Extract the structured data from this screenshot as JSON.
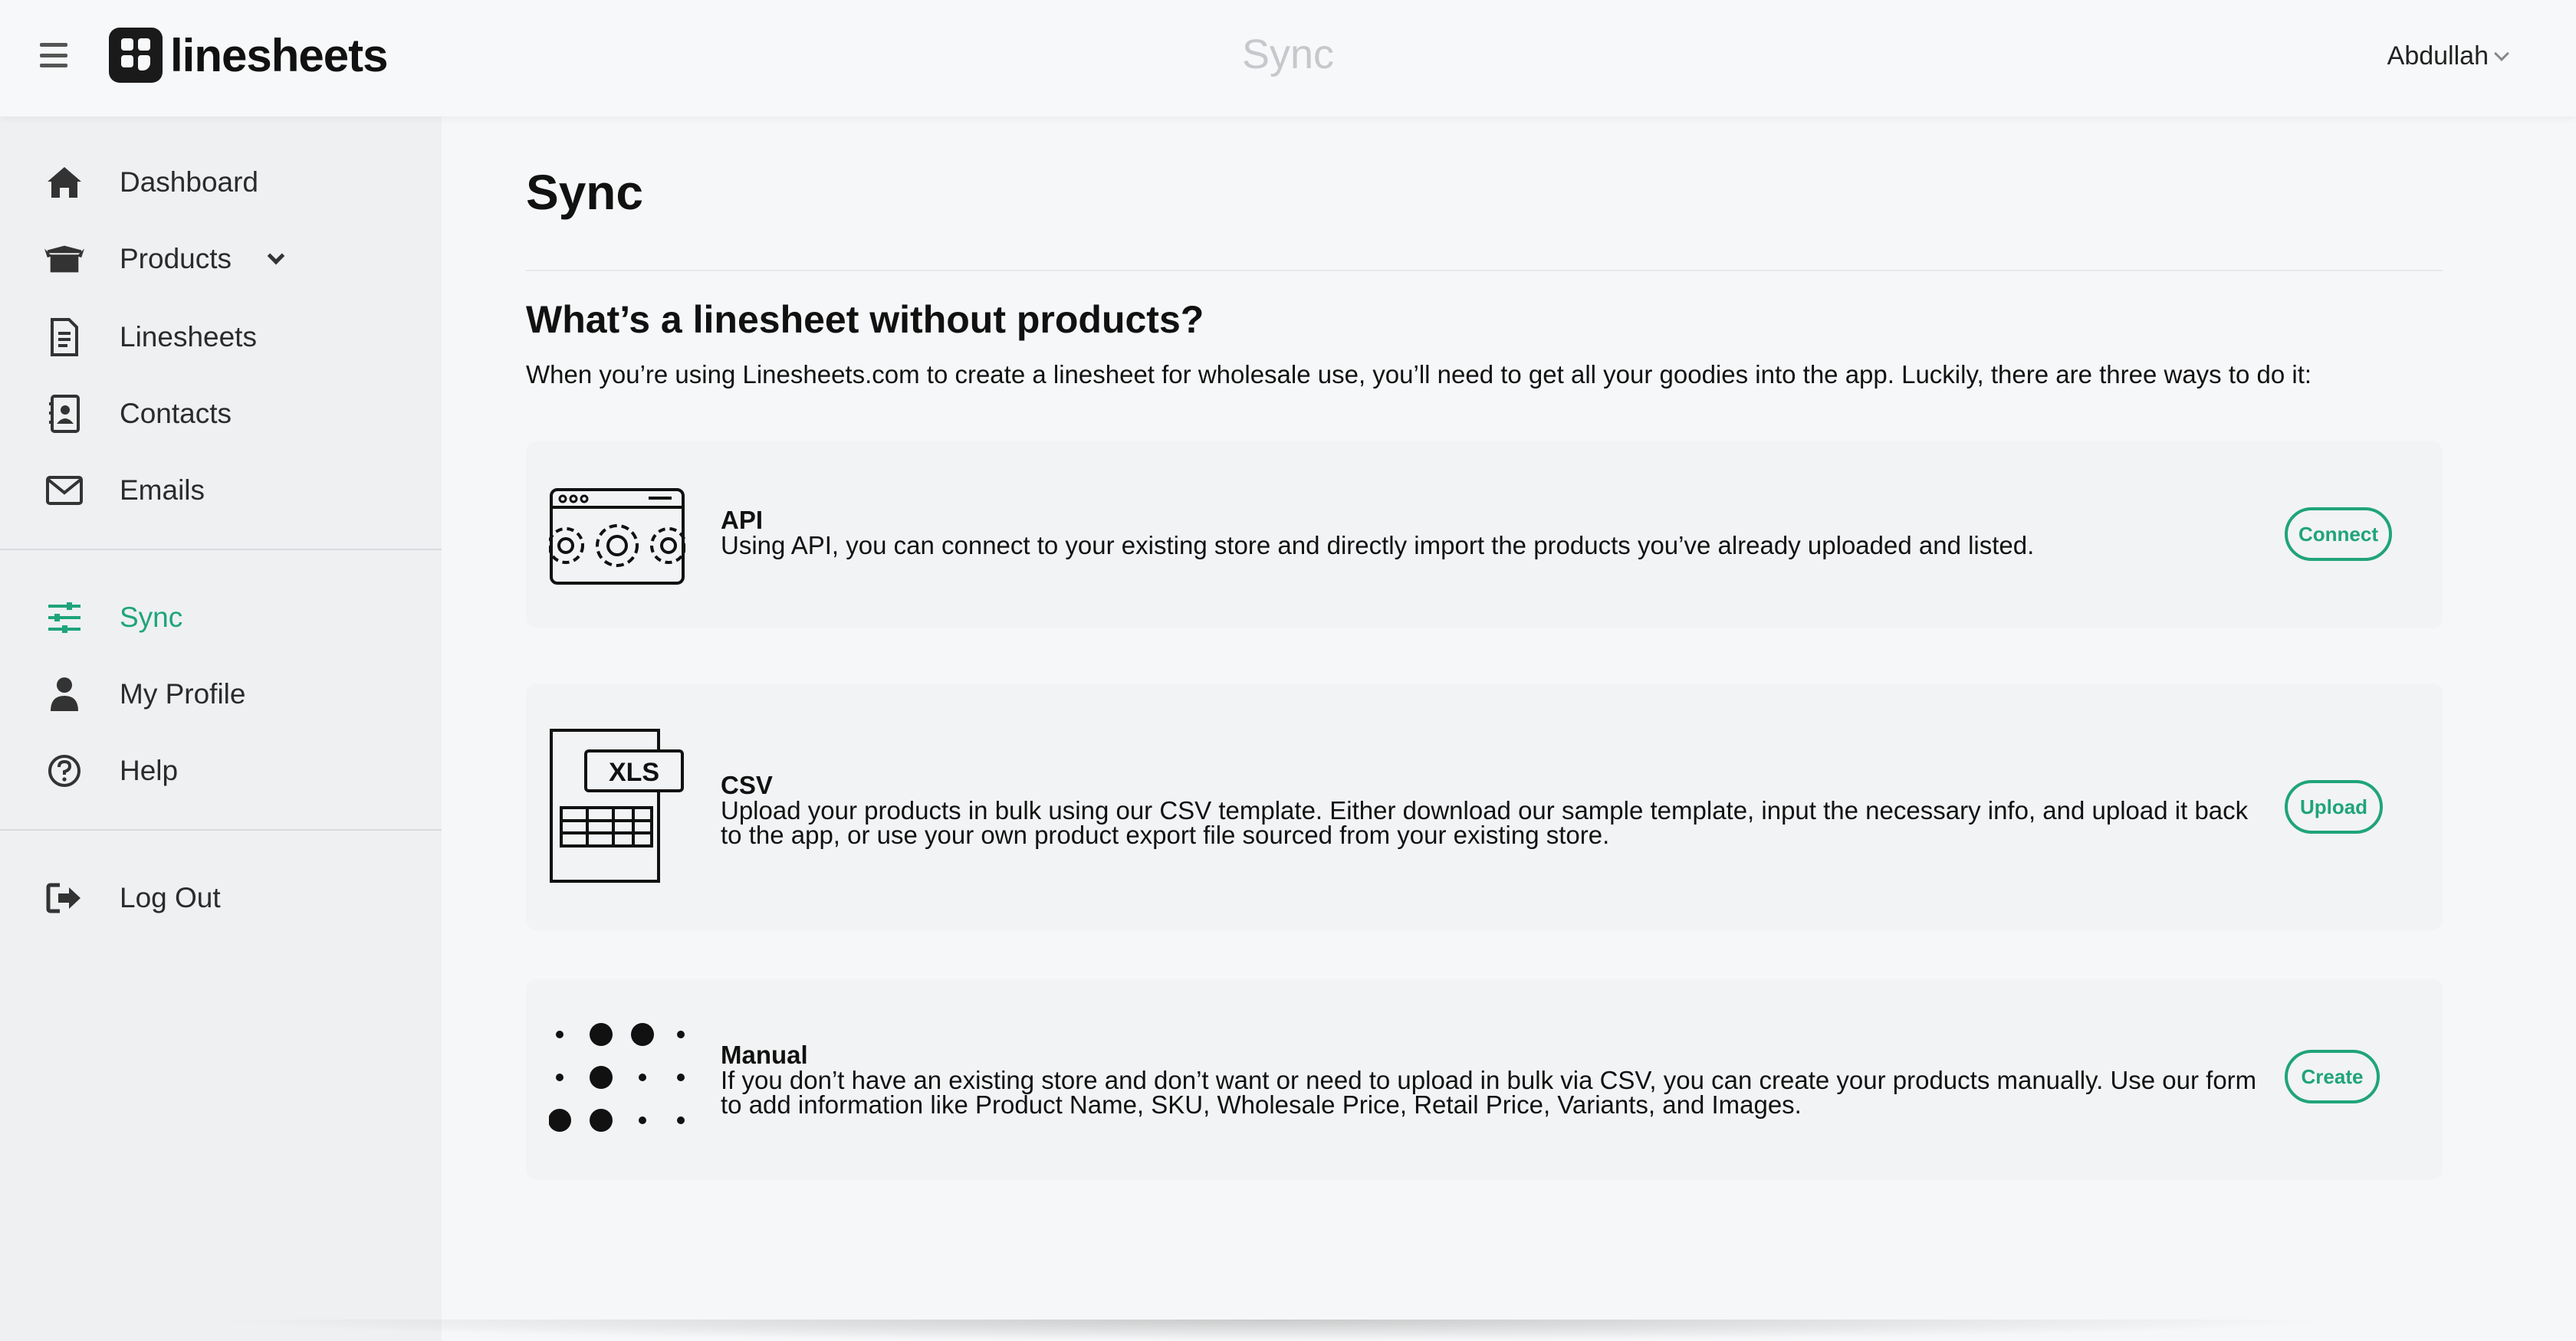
{
  "header": {
    "menu_icon": "hamburger-icon",
    "logo_text": "linesheets",
    "page_title": "Sync",
    "user_name": "Abdullah"
  },
  "sidebar": {
    "items": [
      {
        "label": "Dashboard",
        "icon": "home-icon"
      },
      {
        "label": "Products",
        "icon": "box-icon"
      },
      {
        "label": "Linesheets",
        "icon": "document-icon"
      },
      {
        "label": "Contacts",
        "icon": "address-book-icon"
      },
      {
        "label": "Emails",
        "icon": "envelope-icon"
      },
      {
        "label": "Sync",
        "icon": "sliders-icon",
        "active": true
      },
      {
        "label": "My Profile",
        "icon": "user-icon"
      },
      {
        "label": "Help",
        "icon": "question-circle-icon"
      },
      {
        "label": "Log Out",
        "icon": "sign-out-icon"
      }
    ]
  },
  "main": {
    "title": "Sync",
    "heading": "What’s a linesheet without products?",
    "intro": "When you’re using Linesheets.com to create a linesheet for wholesale use, you’ll need to get all your goodies into the app. Luckily, there are three ways to do it:",
    "cards": [
      {
        "title": "API",
        "description": "Using API, you can connect to your existing store and directly import the products you’ve already uploaded and listed.",
        "button": "Connect",
        "icon": "api-gears-icon"
      },
      {
        "title": "CSV",
        "description": "Upload your products in bulk using our CSV template. Either download our sample template, input the necessary info, and upload it back to the app, or use your own product export file sourced from your existing store.",
        "button": "Upload",
        "icon": "xls-file-icon",
        "icon_label": "XLS"
      },
      {
        "title": "Manual",
        "description": "If you don’t have an existing store and don’t want or need to upload in bulk via CSV, you can create your products manually. Use our form to add information like Product Name, SKU, Wholesale Price, Retail Price, Variants, and Images.",
        "button": "Create",
        "icon": "dots-pattern-icon"
      }
    ]
  },
  "colors": {
    "accent": "#1fa47a",
    "sidebar_bg": "#eef0f2",
    "main_bg": "#f6f7f8",
    "card_bg": "#f2f3f4",
    "header_title": "#c6c8cb"
  }
}
